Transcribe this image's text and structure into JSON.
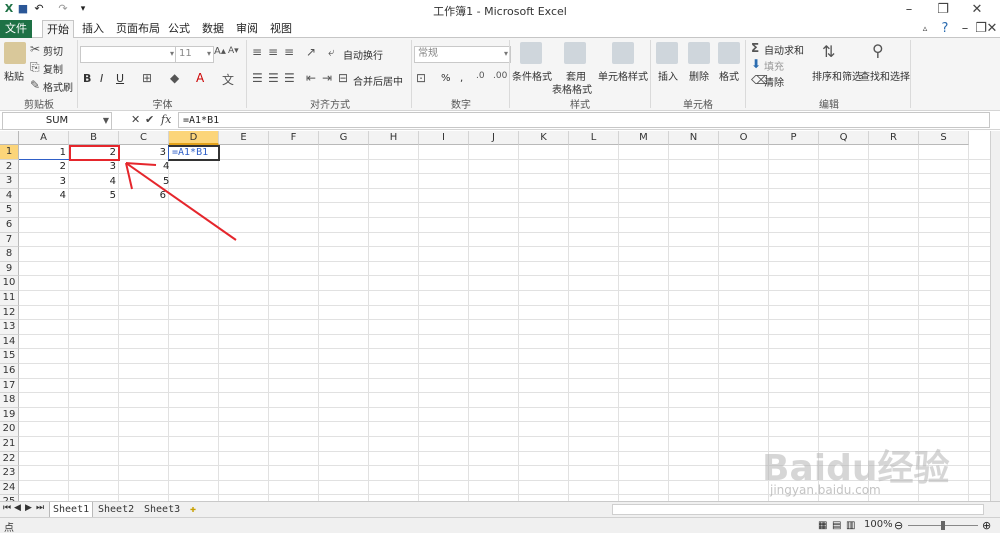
{
  "titlebar": {
    "title": "工作簿1 - Microsoft Excel"
  },
  "tabs": [
    "文件",
    "开始",
    "插入",
    "页面布局",
    "公式",
    "数据",
    "审阅",
    "视图"
  ],
  "ribbon": {
    "clipboard": {
      "paste": "粘贴",
      "cut": "剪切",
      "copy": "复制",
      "format_painter": "格式刷",
      "label": "剪贴板"
    },
    "font": {
      "size": "11",
      "bold": "B",
      "italic": "I",
      "underline": "U",
      "label": "字体"
    },
    "alignment": {
      "wrap": "自动换行",
      "merge": "合并后居中",
      "label": "对齐方式"
    },
    "number": {
      "format": "常规",
      "percent": "%",
      "comma": ",",
      "label": "数字"
    },
    "styles": {
      "conditional": "条件格式",
      "table_line1": "套用",
      "table_line2": "表格格式",
      "cell_styles": "单元格样式",
      "label": "样式"
    },
    "cells": {
      "insert": "插入",
      "delete": "删除",
      "format": "格式",
      "label": "单元格"
    },
    "editing": {
      "autosum": "自动求和",
      "fill": "填充",
      "clear": "清除",
      "sort": "排序和筛选",
      "find": "查找和选择",
      "label": "编辑"
    }
  },
  "formula_bar": {
    "name_box": "SUM",
    "formula": "=A1*B1"
  },
  "grid": {
    "columns": [
      "A",
      "B",
      "C",
      "D",
      "E",
      "F",
      "G",
      "H",
      "I",
      "J",
      "K",
      "L",
      "M",
      "N",
      "O",
      "P",
      "Q",
      "R",
      "S"
    ],
    "rows": [
      "1",
      "2",
      "3",
      "4",
      "5",
      "6",
      "7",
      "8",
      "9",
      "10",
      "11",
      "12",
      "13",
      "14",
      "15",
      "16",
      "17",
      "18",
      "19",
      "20",
      "21",
      "22",
      "23",
      "24",
      "25"
    ],
    "data": [
      [
        "1",
        "2",
        "3",
        "=A1*B1"
      ],
      [
        "2",
        "3",
        "4",
        ""
      ],
      [
        "3",
        "4",
        "5",
        ""
      ],
      [
        "4",
        "5",
        "6",
        ""
      ]
    ]
  },
  "sheets": [
    "Sheet1",
    "Sheet2",
    "Sheet3"
  ],
  "status": {
    "mode": "点",
    "zoom": "100%"
  },
  "watermark": {
    "text": "Baidu经验",
    "url": "jingyan.baidu.com"
  },
  "colors": {
    "accent": "#1e7145",
    "selected_header": "#fcd57a",
    "highlight": "#e5262c",
    "formula_ref": "#2f5fc7"
  }
}
